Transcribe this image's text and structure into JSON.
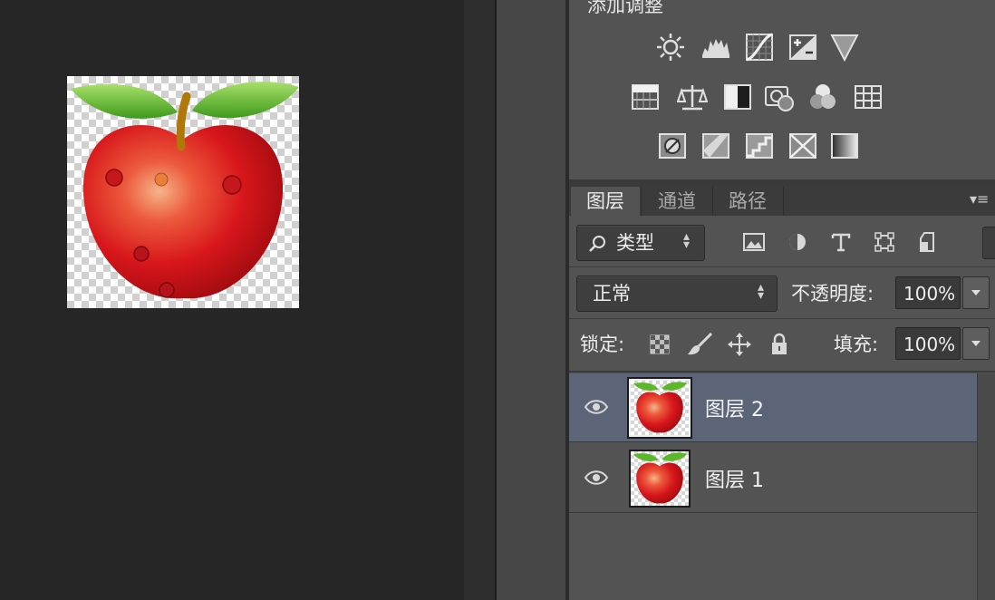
{
  "adjustments": {
    "title": "添加调整",
    "icons_row1": [
      "brightness-contrast-icon",
      "levels-icon",
      "curves-icon",
      "exposure-icon",
      "vibrance-icon"
    ],
    "icons_row2": [
      "hue-saturation-icon",
      "color-balance-icon",
      "black-white-icon",
      "photo-filter-icon",
      "channel-mixer-icon",
      "color-lookup-icon"
    ],
    "icons_row3": [
      "invert-icon",
      "posterize-icon",
      "threshold-icon",
      "selective-color-icon",
      "gradient-map-icon"
    ]
  },
  "tabs": [
    {
      "label": "图层",
      "active": true
    },
    {
      "label": "通道",
      "active": false
    },
    {
      "label": "路径",
      "active": false
    }
  ],
  "panel_menu_glyph": "▾≡",
  "filter": {
    "label": "类型",
    "icons": [
      "image-filter-icon",
      "adjustment-filter-icon",
      "type-filter-icon",
      "shape-filter-icon",
      "smart-object-filter-icon"
    ]
  },
  "blend": {
    "mode": "正常",
    "opacity_label": "不透明度:",
    "opacity_value": "100%"
  },
  "lock": {
    "label": "锁定:",
    "fill_label": "填充:",
    "fill_value": "100%"
  },
  "layers": [
    {
      "name": "图层 2",
      "selected": true
    },
    {
      "name": "图层 1",
      "selected": false
    }
  ],
  "colors": {
    "canvas_bg": "#262626",
    "panel_bg": "#535353",
    "selected_layer": "#5b6577",
    "apple_red": "#d8161b",
    "leaf_green": "#5cb82a"
  }
}
